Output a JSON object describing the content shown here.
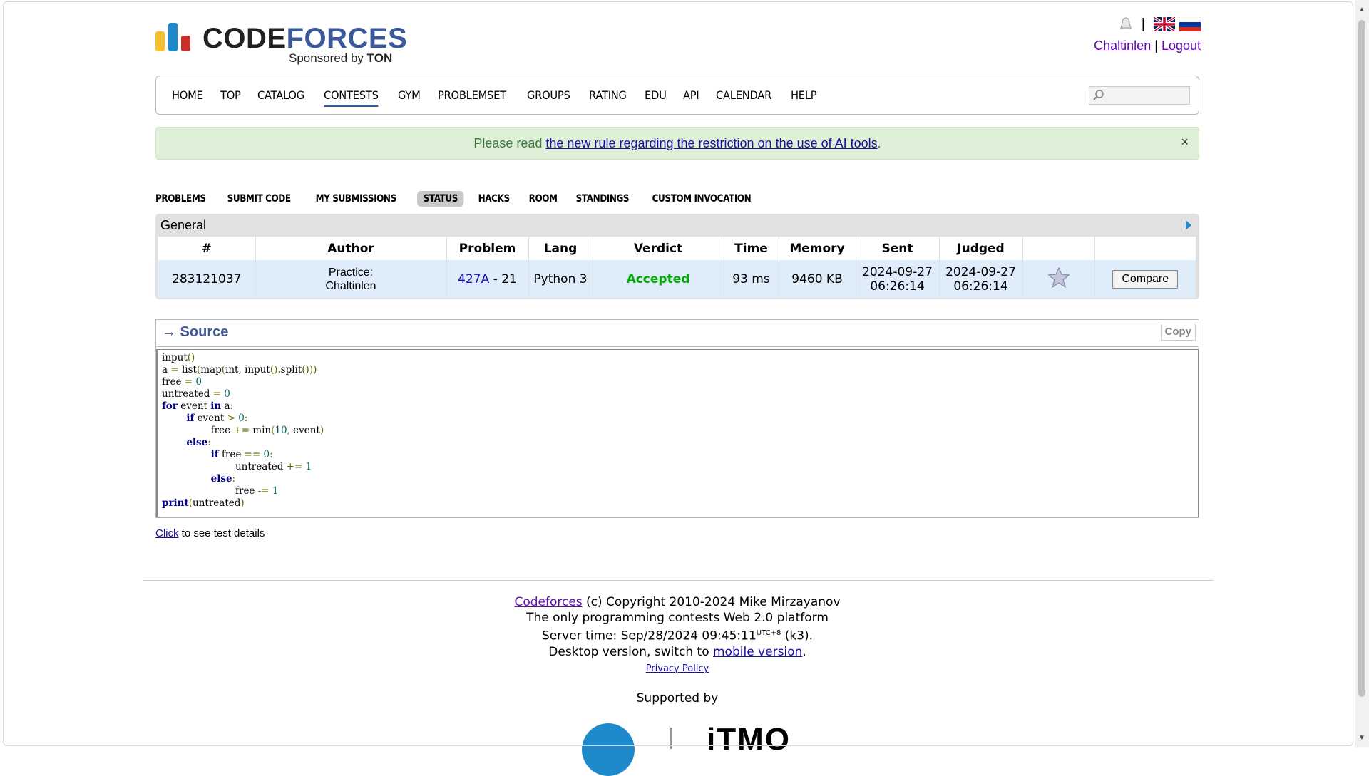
{
  "header": {
    "logo_code": "CODE",
    "logo_forces": "FORCES",
    "sponsored_by": "Sponsored by",
    "sponsor": "TON",
    "separator": "|",
    "user": "Chaltinlen",
    "logout": "Logout"
  },
  "menu": {
    "items": [
      "HOME",
      "TOP",
      "CATALOG",
      "CONTESTS",
      "GYM",
      "PROBLEMSET",
      "GROUPS",
      "RATING",
      "EDU",
      "API",
      "CALENDAR",
      "HELP"
    ],
    "active": "CONTESTS",
    "search_placeholder": ""
  },
  "notice": {
    "prefix": "Please read ",
    "link": "the new rule regarding the restriction on the use of AI tools",
    "suffix": ".",
    "close": "×"
  },
  "submenu": {
    "items": [
      "PROBLEMS",
      "SUBMIT CODE",
      "MY SUBMISSIONS",
      "STATUS",
      "HACKS",
      "ROOM",
      "STANDINGS",
      "CUSTOM INVOCATION"
    ],
    "active": "STATUS"
  },
  "status": {
    "title": "General",
    "columns": [
      "#",
      "Author",
      "Problem",
      "Lang",
      "Verdict",
      "Time",
      "Memory",
      "Sent",
      "Judged",
      "",
      ""
    ],
    "row": {
      "id": "283121037",
      "author_line1": "Practice:",
      "author_line2": "Chaltinlen",
      "problem_link": "427A",
      "problem_suffix": " - 21",
      "lang": "Python 3",
      "verdict": "Accepted",
      "time": "93 ms",
      "memory": "9460 KB",
      "sent_date": "2024-09-27",
      "sent_time": "06:26:14",
      "judged_date": "2024-09-27",
      "judged_time": "06:26:14",
      "compare": "Compare"
    }
  },
  "source": {
    "title": "→ Source",
    "copy": "Copy",
    "lines": [
      "input()",
      "a = list(map(int, input().split()))",
      "free = 0",
      "untreated = 0",
      "for event in a:",
      "        if event > 0:",
      "                free += min(10, event)",
      "        else:",
      "                if free == 0:",
      "                        untreated += 1",
      "                else:",
      "                        free -= 1",
      "print(untreated)"
    ]
  },
  "click_details": {
    "link": "Click",
    "text": " to see test details"
  },
  "footer": {
    "cf_link": "Codeforces",
    "copyright": " (c) Copyright 2010-2024 Mike Mirzayanov",
    "line2": "The only programming contests Web 2.0 platform",
    "server_time_prefix": "Server time: Sep/28/2024 09:45:11",
    "server_tz": "UTC+8",
    "server_time_suffix": " (k3).",
    "desktop_prefix": "Desktop version, switch to ",
    "mobile_link": "mobile version",
    "desktop_suffix": ".",
    "privacy": "Privacy Policy",
    "supported_by": "Supported by",
    "itmo": "iTMO"
  }
}
